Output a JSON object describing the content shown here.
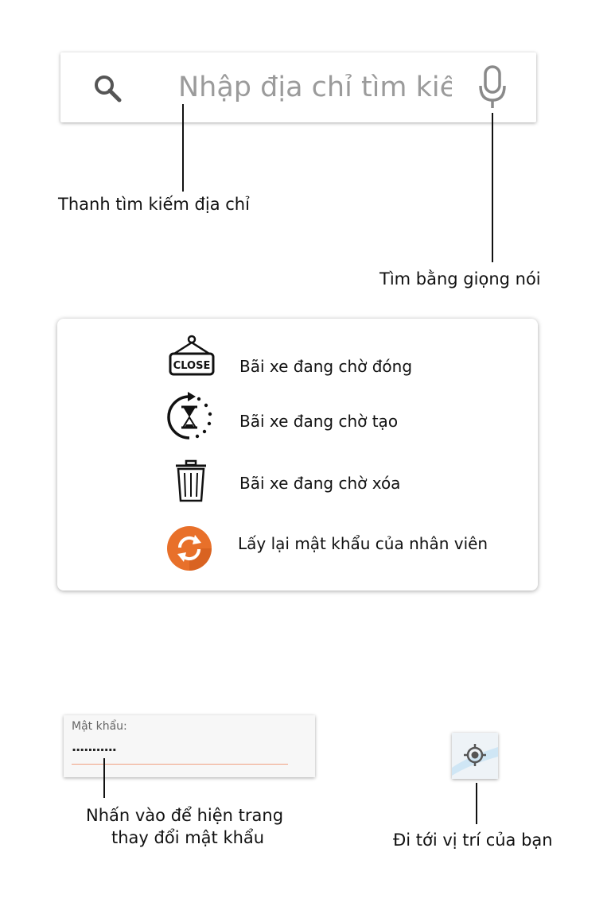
{
  "search_bar": {
    "placeholder": "Nhập địa chỉ tìm kiế",
    "search_icon": "search-icon",
    "mic_icon": "microphone-icon"
  },
  "annotations": {
    "search_bar": "Thanh tìm kiếm địa chỉ",
    "voice_search": "Tìm bằng giọng nói",
    "password_tap_line1": "Nhấn vào để hiện trang",
    "password_tap_line2": "thay đổi mật khẩu",
    "my_location": "Đi tới vị trí của bạn"
  },
  "legend": {
    "items": [
      {
        "icon": "close-sign-icon",
        "icon_text": "CLOSE",
        "label": "Bãi xe đang chờ đóng"
      },
      {
        "icon": "hourglass-pending-icon",
        "label": "Bãi xe đang chờ tạo"
      },
      {
        "icon": "trash-icon",
        "label": "Bãi xe đang chờ xóa"
      },
      {
        "icon": "reset-password-icon",
        "label": "Lấy lại mật khẩu của nhân viên"
      }
    ]
  },
  "password_field": {
    "label": "Mật khẩu:",
    "value": "..........."
  },
  "locate_button": {
    "icon": "crosshair-location-icon"
  },
  "colors": {
    "accent_orange": "#e8702a",
    "underline": "#f0a080",
    "placeholder_gray": "#9b9b9b"
  }
}
